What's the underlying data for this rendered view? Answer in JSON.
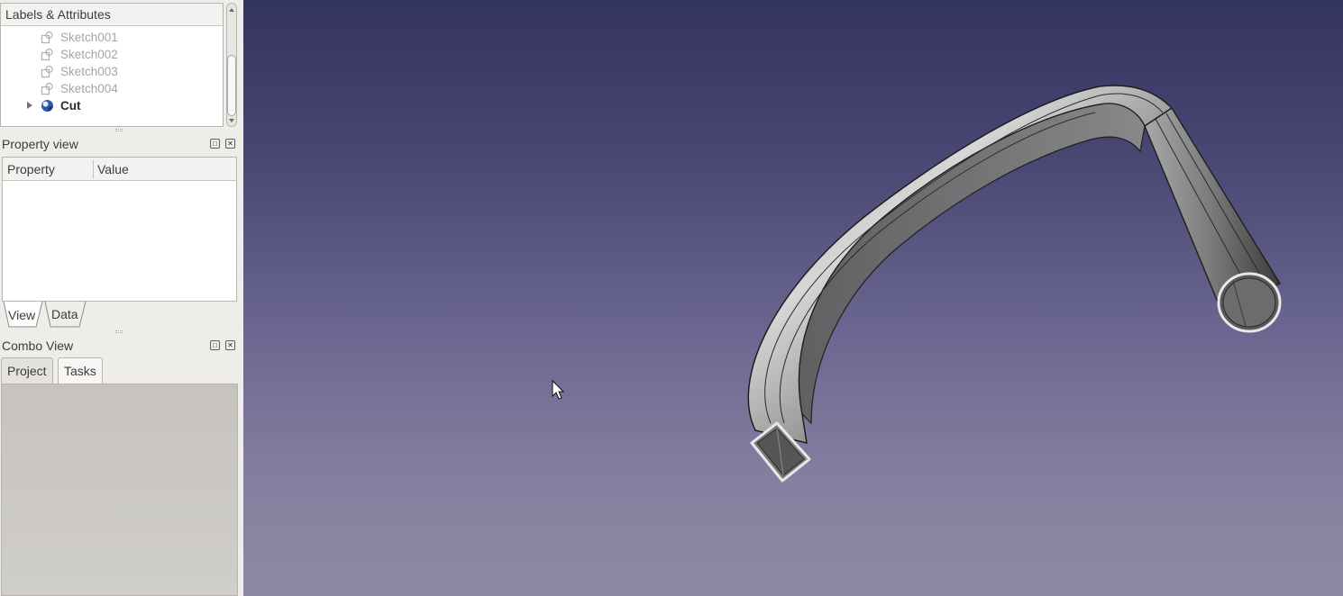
{
  "tree": {
    "header": "Labels & Attributes",
    "items": [
      {
        "label": "Sketch001",
        "icon": "sketch-icon",
        "state": "hidden"
      },
      {
        "label": "Sketch002",
        "icon": "sketch-icon",
        "state": "hidden"
      },
      {
        "label": "Sketch003",
        "icon": "sketch-icon",
        "state": "hidden"
      },
      {
        "label": "Sketch004",
        "icon": "sketch-icon",
        "state": "hidden"
      },
      {
        "label": "Cut",
        "icon": "cut-boolean-icon",
        "state": "visible",
        "expandable": true
      }
    ]
  },
  "property_view": {
    "title": "Property view",
    "columns": [
      "Property",
      "Value"
    ],
    "tabs": [
      "View",
      "Data"
    ],
    "active_tab": "View"
  },
  "combo_view": {
    "title": "Combo View",
    "tabs": [
      "Project",
      "Tasks"
    ],
    "active_tab": "Tasks"
  },
  "viewport": {
    "object": "Cut",
    "background_top": "#33345f",
    "background_bottom": "#8f88a4",
    "model_color": "#8c8c8c"
  },
  "icons": {
    "float": "float-window-icon",
    "close": "close-icon",
    "cursor": "mouse-cursor-icon"
  }
}
